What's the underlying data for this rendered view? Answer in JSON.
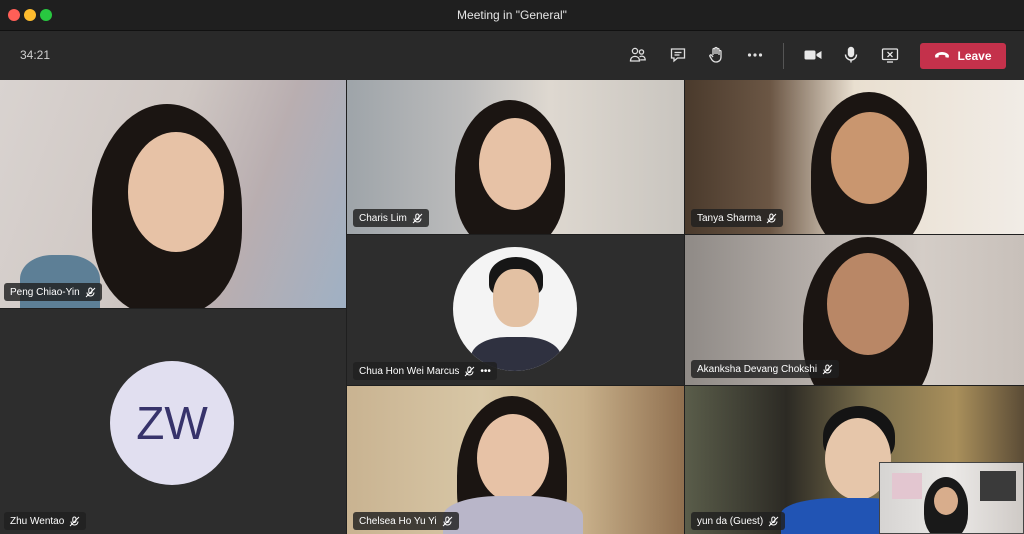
{
  "window": {
    "title": "Meeting in \"General\""
  },
  "toolbar": {
    "timer": "34:21",
    "leave_label": "Leave",
    "icons": [
      "participants-icon",
      "chat-icon",
      "raise-hand-icon",
      "more-actions-icon",
      "camera-icon",
      "microphone-icon",
      "share-screen-icon",
      "phone-hangup-icon"
    ]
  },
  "participants": [
    {
      "name": "Peng Chiao-Yin",
      "muted": true,
      "video": true
    },
    {
      "name": "Charis Lim",
      "muted": true,
      "video": true
    },
    {
      "name": "Tanya Sharma",
      "muted": true,
      "video": true
    },
    {
      "name": "Chua Hon Wei Marcus",
      "muted": true,
      "video": false,
      "more": "•••"
    },
    {
      "name": "Akanksha Devang Chokshi",
      "muted": true,
      "video": true
    },
    {
      "name": "Zhu Wentao",
      "muted": true,
      "video": false,
      "initials": "ZW"
    },
    {
      "name": "Chelsea Ho Yu Yi",
      "muted": true,
      "video": true
    },
    {
      "name": "yun da (Guest)",
      "muted": true,
      "video": true
    }
  ],
  "colors": {
    "leave": "#c4314b",
    "avatar_bg": "#e1dff0",
    "avatar_text": "#37336b"
  }
}
